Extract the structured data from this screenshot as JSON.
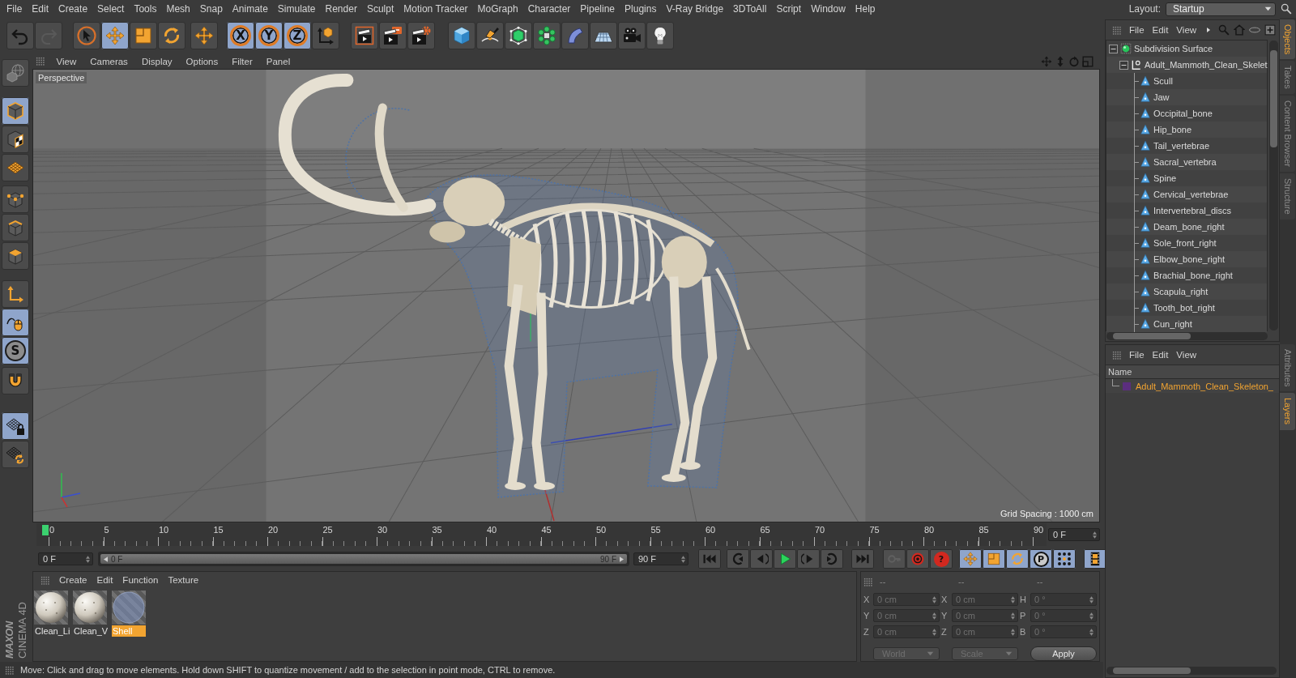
{
  "menu_bar": {
    "items": [
      "File",
      "Edit",
      "Create",
      "Select",
      "Tools",
      "Mesh",
      "Snap",
      "Animate",
      "Simulate",
      "Render",
      "Sculpt",
      "Motion Tracker",
      "MoGraph",
      "Character",
      "Pipeline",
      "Plugins",
      "V-Ray Bridge",
      "3DToAll",
      "Script",
      "Window",
      "Help"
    ],
    "layout_label": "Layout:",
    "layout": "Startup"
  },
  "toolbar": {
    "groups": [
      {
        "buttons": [
          {
            "selected": false,
            "disabled": false
          },
          {
            "selected": false,
            "disabled": true
          }
        ]
      },
      {
        "buttons": [
          {
            "selected": false,
            "disabled": false
          },
          {
            "selected": true,
            "disabled": false
          },
          {
            "selected": false,
            "disabled": false
          },
          {
            "selected": false,
            "disabled": false
          }
        ]
      },
      {
        "buttons": [
          {
            "selected": false,
            "disabled": false
          }
        ]
      },
      {
        "buttons": [
          {
            "label": "X",
            "selected": true,
            "disabled": false
          },
          {
            "label": "Y",
            "selected": true,
            "disabled": false
          },
          {
            "label": "Z",
            "selected": true,
            "disabled": false
          },
          {
            "selected": false,
            "disabled": false
          }
        ]
      },
      {
        "buttons": [
          {
            "selected": false,
            "disabled": false
          },
          {
            "selected": false,
            "disabled": false
          },
          {
            "selected": false,
            "disabled": false
          }
        ]
      },
      {
        "buttons": [
          {
            "selected": false,
            "disabled": false
          },
          {
            "selected": false,
            "disabled": false
          },
          {
            "selected": false,
            "disabled": false
          },
          {
            "selected": false,
            "disabled": false
          },
          {
            "selected": false,
            "disabled": false
          },
          {
            "selected": false,
            "disabled": false
          },
          {
            "selected": false,
            "disabled": false
          },
          {
            "selected": false,
            "disabled": false
          }
        ]
      }
    ]
  },
  "left_toolbar": {
    "groups": [
      {
        "buttons": [
          {
            "selected": false
          }
        ]
      },
      {
        "buttons": [
          {
            "selected": true
          },
          {
            "selected": false
          },
          {
            "selected": false
          }
        ]
      },
      {
        "buttons": [
          {
            "selected": false
          },
          {
            "selected": false
          },
          {
            "selected": false
          }
        ]
      },
      {
        "buttons": [
          {
            "selected": false
          },
          {
            "selected": true
          },
          {
            "label": "S",
            "selected": true
          }
        ]
      },
      {
        "buttons": [
          {
            "selected": false
          }
        ]
      },
      {
        "buttons": [
          {
            "selected": true
          },
          {
            "selected": false
          }
        ]
      }
    ]
  },
  "viewport": {
    "menu": [
      "View",
      "Cameras",
      "Display",
      "Options",
      "Filter",
      "Panel"
    ],
    "camera": "Perspective",
    "grid_spacing": "Grid Spacing : 1000 cm"
  },
  "timeline": {
    "ticks": [
      "0",
      "5",
      "10",
      "15",
      "20",
      "25",
      "30",
      "35",
      "40",
      "45",
      "50",
      "55",
      "60",
      "65",
      "70",
      "75",
      "80",
      "85",
      "90"
    ],
    "playhead": {
      "level": 0
    },
    "frame": "0 F"
  },
  "playback": {
    "start": "0 F",
    "preview_range": {
      "start": "0 F",
      "end": "90 F",
      "level": 1
    },
    "end": "90 F",
    "groups": [
      {
        "buttons": [
          {
            "selected": false,
            "disabled": false
          }
        ]
      },
      {
        "buttons": [
          {
            "selected": false,
            "disabled": false
          },
          {
            "selected": false,
            "disabled": false
          },
          {
            "selected": false,
            "disabled": false
          },
          {
            "selected": false,
            "disabled": false
          },
          {
            "selected": false,
            "disabled": false
          }
        ]
      },
      {
        "buttons": [
          {
            "selected": false,
            "disabled": false
          }
        ]
      },
      {
        "buttons": [
          {
            "selected": false,
            "disabled": true
          },
          {
            "selected": false,
            "disabled": false
          },
          {
            "label": "?",
            "selected": false,
            "disabled": false
          }
        ]
      },
      {
        "buttons": [
          {
            "selected": true,
            "disabled": false
          },
          {
            "selected": true,
            "disabled": false
          },
          {
            "selected": true,
            "disabled": false
          },
          {
            "label": "P",
            "selected": true,
            "disabled": false
          },
          {
            "selected": true,
            "disabled": false
          }
        ]
      },
      {
        "buttons": [
          {
            "selected": true,
            "disabled": false
          }
        ]
      }
    ]
  },
  "materials": {
    "menu": [
      "Create",
      "Edit",
      "Function",
      "Texture"
    ],
    "items": [
      {
        "name": "Clean_Li",
        "kind": "stone",
        "selected": false
      },
      {
        "name": "Clean_V",
        "kind": "stone",
        "selected": false
      },
      {
        "name": "Shell",
        "kind": "glass",
        "selected": true
      }
    ]
  },
  "coordinates": {
    "disabled": true,
    "headers": [
      "--",
      "--",
      "--"
    ],
    "rows": [
      {
        "position_axis": "X",
        "position": "0 cm",
        "size_axis": "X",
        "size": "0 cm",
        "rotation_axis": "H",
        "rotation": "0 °"
      },
      {
        "position_axis": "Y",
        "position": "0 cm",
        "size_axis": "Y",
        "size": "0 cm",
        "rotation_axis": "P",
        "rotation": "0 °"
      },
      {
        "position_axis": "Z",
        "position": "0 cm",
        "size_axis": "Z",
        "size": "0 cm",
        "rotation_axis": "B",
        "rotation": "0 °"
      }
    ],
    "mode": "World",
    "size_mode": "Scale",
    "apply": "Apply"
  },
  "logo": {
    "brand": "MAXON",
    "product": "CINEMA 4D"
  },
  "status_bar": "Move: Click and drag to move elements. Hold down SHIFT to quantize movement / add to the selection in point mode, CTRL to remove.",
  "objects_manager": {
    "menu": [
      "File",
      "Edit",
      "View"
    ],
    "tree": [
      {
        "name": "Subdivision Surface",
        "kind": "subdivision",
        "expanded": true,
        "children": [
          {
            "name": "Adult_Mammoth_Clean_Skelet",
            "kind": "null",
            "expanded": true,
            "children": [
              {
                "name": "Scull",
                "kind": "joint"
              },
              {
                "name": "Jaw",
                "kind": "joint"
              },
              {
                "name": "Occipital_bone",
                "kind": "joint"
              },
              {
                "name": "Hip_bone",
                "kind": "joint"
              },
              {
                "name": "Tail_vertebrae",
                "kind": "joint"
              },
              {
                "name": "Sacral_vertebra",
                "kind": "joint"
              },
              {
                "name": "Spine",
                "kind": "joint"
              },
              {
                "name": "Cervical_vertebrae",
                "kind": "joint"
              },
              {
                "name": "Intervertebral_discs",
                "kind": "joint"
              },
              {
                "name": "Deam_bone_right",
                "kind": "joint"
              },
              {
                "name": "Sole_front_right",
                "kind": "joint"
              },
              {
                "name": "Elbow_bone_right",
                "kind": "joint"
              },
              {
                "name": "Brachial_bone_right",
                "kind": "joint"
              },
              {
                "name": "Scapula_right",
                "kind": "joint"
              },
              {
                "name": "Tooth_bot_right",
                "kind": "joint"
              },
              {
                "name": "Cun_right",
                "kind": "joint"
              }
            ]
          }
        ]
      }
    ]
  },
  "objects_tabs": [
    {
      "label": "Objects",
      "selected": true
    },
    {
      "label": "Takes",
      "selected": false
    },
    {
      "label": "Content Browser",
      "selected": false
    },
    {
      "label": "Structure",
      "selected": false
    }
  ],
  "layers_manager": {
    "menu": [
      "File",
      "Edit",
      "View"
    ],
    "column": "Name",
    "items": [
      {
        "name": "Adult_Mammoth_Clean_Skeleton_",
        "color": "#5b2e7e"
      }
    ]
  },
  "layers_tabs": [
    {
      "label": "Attributes",
      "selected": false
    },
    {
      "label": "Layers",
      "selected": true
    }
  ]
}
